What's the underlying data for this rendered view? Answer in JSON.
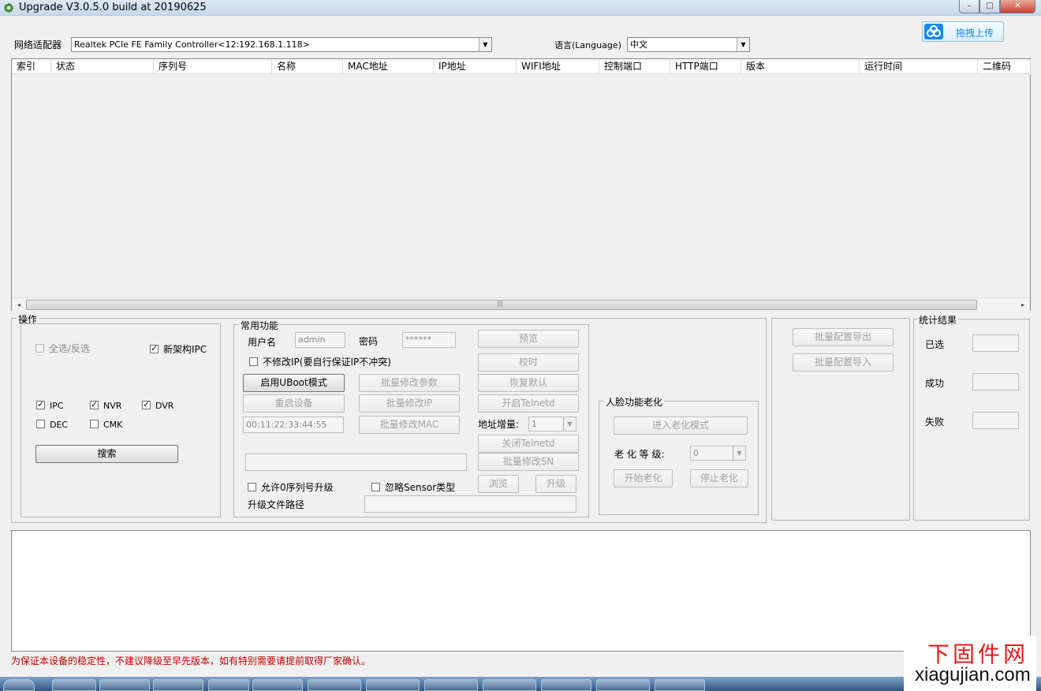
{
  "window": {
    "title": "Upgrade V3.0.5.0 build at 20190625",
    "min_glyph": "–",
    "max_glyph": "□",
    "close_glyph": "✕"
  },
  "top": {
    "adapter_label": "网络适配器",
    "adapter_value": "Realtek PCIe FE Family Controller<12:192.168.1.118>",
    "language_label": "语言(Language)",
    "language_value": "中文",
    "cloud_button": "拖拽上传"
  },
  "device_list": {
    "columns": [
      "索引",
      "状态",
      "序列号",
      "名称",
      "MAC地址",
      "IP地址",
      "WIFI地址",
      "控制端口",
      "HTTP端口",
      "版本",
      "运行时间",
      "二维码"
    ],
    "scroll_grip": "|||"
  },
  "operations": {
    "title": "操作",
    "select_all": "全选/反选",
    "new_arch_ipc": "新架构IPC",
    "types": [
      "IPC",
      "NVR",
      "DVR",
      "DEC",
      "CMK"
    ],
    "search_button": "搜索"
  },
  "common": {
    "title": "常用功能",
    "username_label": "用户名",
    "username_value": "admin",
    "password_label": "密码",
    "password_value": "******",
    "no_modify_ip": "不修改IP(要自行保证IP不冲突)",
    "uboot_button": "启用UBoot模式",
    "reboot_button": "重启设备",
    "mac_value": "00:11:22:33:44:55",
    "batch_params_button": "批量修改参数",
    "batch_ip_button": "批量修改IP",
    "batch_mac_button": "批量修改MAC",
    "preview_button": "预览",
    "time_sync_button": "校时",
    "restore_default_button": "恢复默认",
    "telnet_on_button": "开启Telnetd",
    "address_increment_label": "地址增量:",
    "address_increment_value": "1",
    "telnet_off_button": "关闭Telnetd",
    "batch_sn_button": "批量修改SN",
    "allow_zero_sn": "允许0序列号升级",
    "ignore_sensor": "忽略Sensor类型",
    "browse_button": "浏览",
    "upgrade_button": "升级",
    "upgrade_path_label": "升级文件路径"
  },
  "aging": {
    "title": "人脸功能老化",
    "enter_button": "进入老化模式",
    "level_label": "老 化 等 级:",
    "level_value": "0",
    "start_button": "开始老化",
    "stop_button": "停止老化"
  },
  "config": {
    "export_button": "批量配置导出",
    "import_button": "批量配置导入"
  },
  "stats": {
    "title": "统计结果",
    "selected_label": "已选",
    "success_label": "成功",
    "fail_label": "失败"
  },
  "warning": "为保证本设备的稳定性，不建议降级至早先版本，如有特别需要请提前取得厂家确认。",
  "watermark": {
    "cn": "下固件网",
    "en": "xiagujian.com"
  }
}
